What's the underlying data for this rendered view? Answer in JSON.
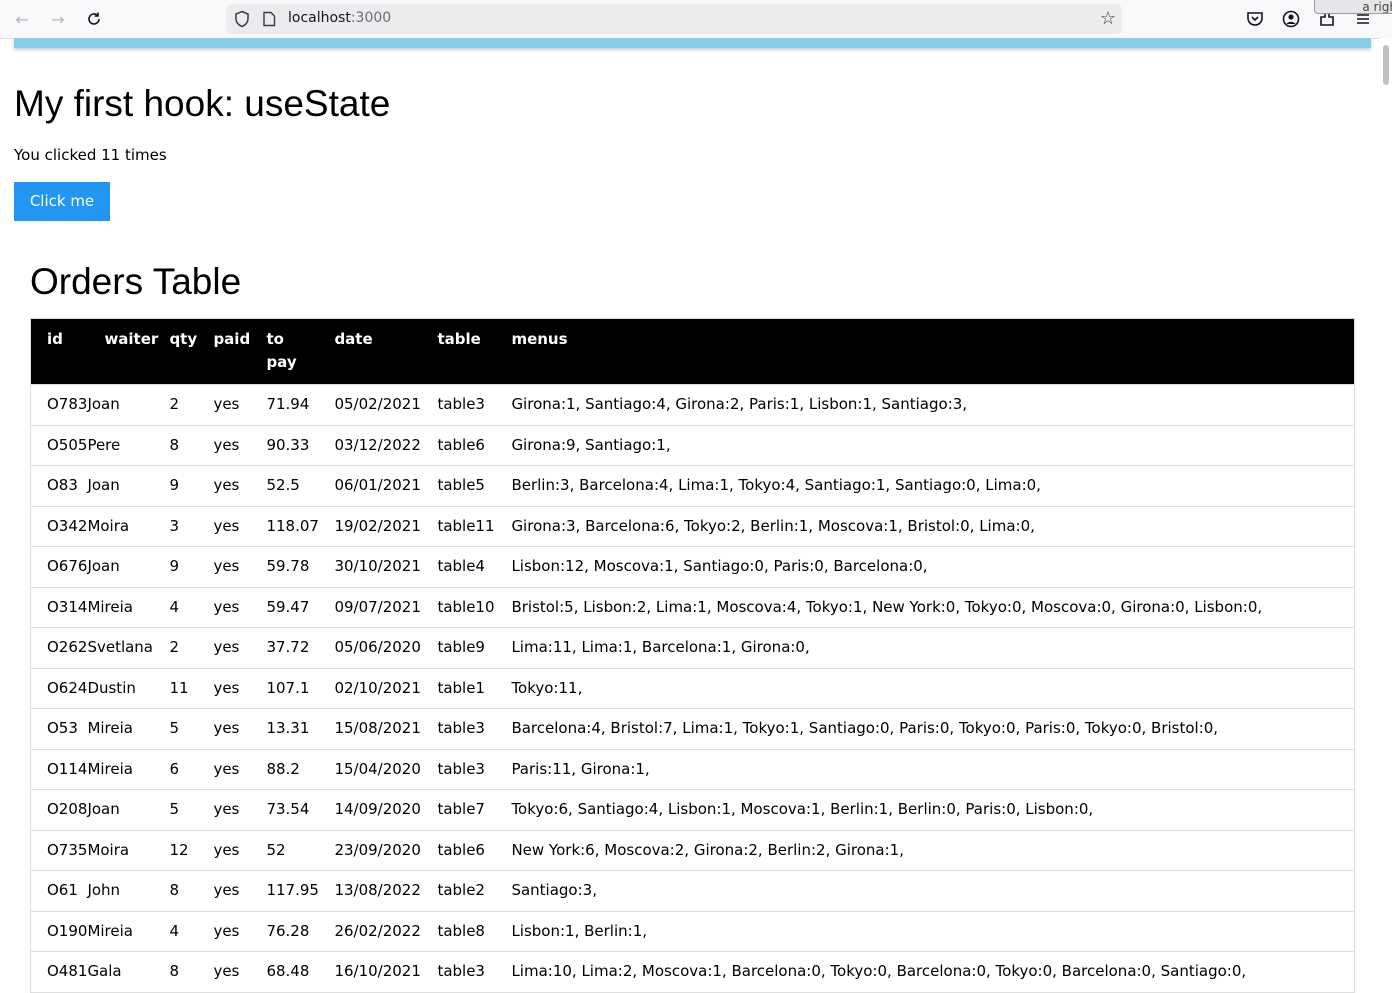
{
  "browser": {
    "url_host": "localhost",
    "url_port": ":3000",
    "tooltip": "a righ"
  },
  "page": {
    "title": "My first hook: useState",
    "click_text": "You clicked 11 times",
    "button_label": "Click me",
    "table_title": "Orders Table"
  },
  "table": {
    "headers": {
      "id": "id",
      "waiter": "waiter",
      "qty": "qty",
      "paid": "paid",
      "to_pay_1": "to",
      "to_pay_2": "pay",
      "date": "date",
      "table": "table",
      "menus": "menus"
    },
    "rows": [
      {
        "id": "O783",
        "waiter": "Joan",
        "qty": "2",
        "paid": "yes",
        "topay": "71.94",
        "date": "05/02/2021",
        "table": "table3",
        "menus": "Girona:1, Santiago:4, Girona:2, Paris:1, Lisbon:1, Santiago:3,"
      },
      {
        "id": "O505",
        "waiter": "Pere",
        "qty": "8",
        "paid": "yes",
        "topay": "90.33",
        "date": "03/12/2022",
        "table": "table6",
        "menus": "Girona:9, Santiago:1,"
      },
      {
        "id": "O83",
        "waiter": "Joan",
        "qty": "9",
        "paid": "yes",
        "topay": "52.5",
        "date": "06/01/2021",
        "table": "table5",
        "menus": "Berlin:3, Barcelona:4, Lima:1, Tokyo:4, Santiago:1, Santiago:0, Lima:0,"
      },
      {
        "id": "O342",
        "waiter": "Moira",
        "qty": "3",
        "paid": "yes",
        "topay": "118.07",
        "date": "19/02/2021",
        "table": "table11",
        "menus": "Girona:3, Barcelona:6, Tokyo:2, Berlin:1, Moscova:1, Bristol:0, Lima:0,"
      },
      {
        "id": "O676",
        "waiter": "Joan",
        "qty": "9",
        "paid": "yes",
        "topay": "59.78",
        "date": "30/10/2021",
        "table": "table4",
        "menus": "Lisbon:12, Moscova:1, Santiago:0, Paris:0, Barcelona:0,"
      },
      {
        "id": "O314",
        "waiter": "Mireia",
        "qty": "4",
        "paid": "yes",
        "topay": "59.47",
        "date": "09/07/2021",
        "table": "table10",
        "menus": "Bristol:5, Lisbon:2, Lima:1, Moscova:4, Tokyo:1, New York:0, Tokyo:0, Moscova:0, Girona:0, Lisbon:0,"
      },
      {
        "id": "O262",
        "waiter": "Svetlana",
        "qty": "2",
        "paid": "yes",
        "topay": "37.72",
        "date": "05/06/2020",
        "table": "table9",
        "menus": "Lima:11, Lima:1, Barcelona:1, Girona:0,"
      },
      {
        "id": "O624",
        "waiter": "Dustin",
        "qty": "11",
        "paid": "yes",
        "topay": "107.1",
        "date": "02/10/2021",
        "table": "table1",
        "menus": "Tokyo:11,"
      },
      {
        "id": "O53",
        "waiter": "Mireia",
        "qty": "5",
        "paid": "yes",
        "topay": "13.31",
        "date": "15/08/2021",
        "table": "table3",
        "menus": "Barcelona:4, Bristol:7, Lima:1, Tokyo:1, Santiago:0, Paris:0, Tokyo:0, Paris:0, Tokyo:0, Bristol:0,"
      },
      {
        "id": "O114",
        "waiter": "Mireia",
        "qty": "6",
        "paid": "yes",
        "topay": "88.2",
        "date": "15/04/2020",
        "table": "table3",
        "menus": "Paris:11, Girona:1,"
      },
      {
        "id": "O208",
        "waiter": "Joan",
        "qty": "5",
        "paid": "yes",
        "topay": "73.54",
        "date": "14/09/2020",
        "table": "table7",
        "menus": "Tokyo:6, Santiago:4, Lisbon:1, Moscova:1, Berlin:1, Berlin:0, Paris:0, Lisbon:0,"
      },
      {
        "id": "O735",
        "waiter": "Moira",
        "qty": "12",
        "paid": "yes",
        "topay": "52",
        "date": "23/09/2020",
        "table": "table6",
        "menus": "New York:6, Moscova:2, Girona:2, Berlin:2, Girona:1,"
      },
      {
        "id": "O61",
        "waiter": "John",
        "qty": "8",
        "paid": "yes",
        "topay": "117.95",
        "date": "13/08/2022",
        "table": "table2",
        "menus": "Santiago:3,"
      },
      {
        "id": "O190",
        "waiter": "Mireia",
        "qty": "4",
        "paid": "yes",
        "topay": "76.28",
        "date": "26/02/2022",
        "table": "table8",
        "menus": "Lisbon:1, Berlin:1,"
      },
      {
        "id": "O481",
        "waiter": "Gala",
        "qty": "8",
        "paid": "yes",
        "topay": "68.48",
        "date": "16/10/2021",
        "table": "table3",
        "menus": "Lima:10, Lima:2, Moscova:1, Barcelona:0, Tokyo:0, Barcelona:0, Tokyo:0, Barcelona:0, Santiago:0,"
      }
    ]
  }
}
